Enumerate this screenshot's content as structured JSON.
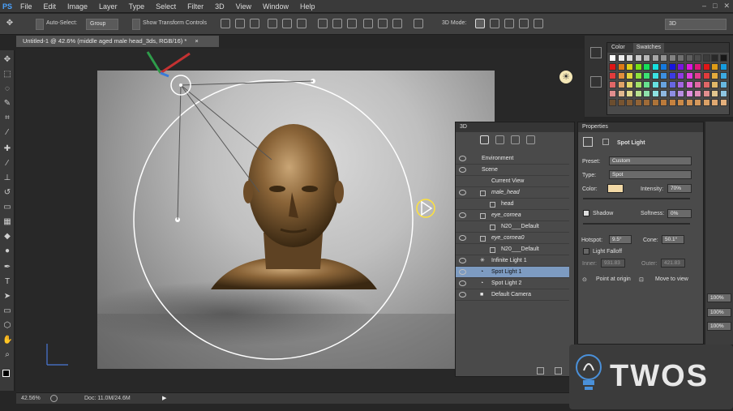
{
  "menubar": {
    "app_logo": "PS",
    "items": [
      "File",
      "Edit",
      "Image",
      "Layer",
      "Type",
      "Select",
      "Filter",
      "3D",
      "View",
      "Window",
      "Help"
    ]
  },
  "options": {
    "auto_select_label": "Auto-Select:",
    "group_value": "Group",
    "transform_label": "Show Transform Controls",
    "mode_label": "3D Mode:",
    "workspace_value": "3D"
  },
  "document": {
    "tab_title": "Untitled-1 @ 42.6% (middle aged male head_3ds, RGB/16) *",
    "tab_close": "×"
  },
  "status": {
    "zoom": "42.56%",
    "doc_info": "Doc: 11.0M/24.6M"
  },
  "panel3d": {
    "title": "3D",
    "rows": [
      {
        "label": "Environment",
        "indent": 0
      },
      {
        "label": "Scene",
        "indent": 0
      },
      {
        "label": "Current View",
        "indent": 1
      },
      {
        "label": "male_head",
        "indent": 1
      },
      {
        "label": "head",
        "indent": 2
      },
      {
        "label": "eye_cornea",
        "indent": 1
      },
      {
        "label": "N20___Default",
        "indent": 2
      },
      {
        "label": "eye_cornea0",
        "indent": 1
      },
      {
        "label": "N20___Default",
        "indent": 2
      },
      {
        "label": "Infinite Light 1",
        "indent": 0
      },
      {
        "label": "Spot Light 1",
        "indent": 0
      },
      {
        "label": "Spot Light 2",
        "indent": 0
      },
      {
        "label": "Default Camera",
        "indent": 0
      }
    ]
  },
  "properties": {
    "title": "Properties",
    "heading": "Spot Light",
    "preset_label": "Preset:",
    "preset_value": "Custom",
    "type_label": "Type:",
    "type_value": "Spot",
    "color_label": "Color:",
    "intensity_label": "Intensity:",
    "intensity_value": "70%",
    "shadow_label": "Shadow",
    "softness_label": "Softness:",
    "softness_value": "0%",
    "hotspot_label": "Hotspot:",
    "hotspot_value": "9.5°",
    "cone_label": "Cone:",
    "cone_value": "50.1°",
    "falloff_label": "Light Falloff",
    "inner_label": "Inner:",
    "inner_value": "931.83",
    "outer_label": "Outer:",
    "outer_value": "421.83",
    "point_origin_label": "Point at origin",
    "move_view_label": "Move to view"
  },
  "swatches": {
    "tab_color": "Color",
    "tab_swatches": "Swatches"
  },
  "right_fields": [
    "100%",
    "100%",
    "100%"
  ],
  "watermark": "TWOS",
  "colors": {
    "accent": "#7d9bc1",
    "light_color": "#f2d9a6",
    "brand": "#4aa3ff"
  }
}
